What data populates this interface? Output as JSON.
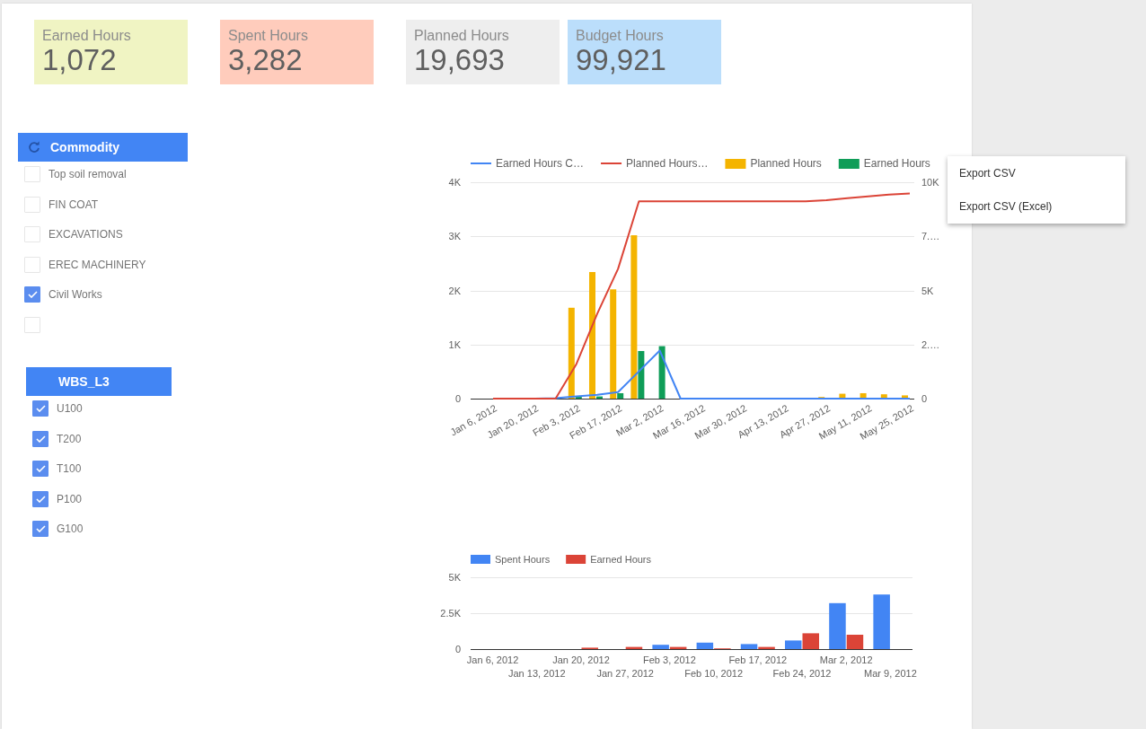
{
  "scorecards": [
    {
      "label": "Earned Hours",
      "value": "1,072",
      "color": "#f0f4c3"
    },
    {
      "label": "Spent Hours",
      "value": "3,282",
      "color": "#ffccbc"
    },
    {
      "label": "Planned Hours",
      "value": "19,693",
      "color": "#eeeeee"
    },
    {
      "label": "Budget Hours",
      "value": "99,921",
      "color": "#bbdefb"
    }
  ],
  "filters": [
    {
      "title": "Commodity",
      "show_reset": true,
      "options": [
        {
          "label": "Top soil removal",
          "checked": false
        },
        {
          "label": "FIN COAT",
          "checked": false
        },
        {
          "label": "EXCAVATIONS",
          "checked": false
        },
        {
          "label": "EREC MACHINERY",
          "checked": false
        },
        {
          "label": "Civil Works",
          "checked": true
        },
        {
          "checked": false
        }
      ]
    },
    {
      "title": "WBS_L3",
      "show_reset": false,
      "options": [
        {
          "label": "U100",
          "checked": true
        },
        {
          "label": "T200",
          "checked": true
        },
        {
          "label": "T100",
          "checked": true
        },
        {
          "label": "P100",
          "checked": true
        },
        {
          "label": "G100",
          "checked": true
        }
      ]
    }
  ],
  "charts": [
    {
      "chart_data": {
        "type": "bar",
        "legend": "top",
        "grid": true,
        "categories": [
          "Jan 6, 2012",
          null,
          "Jan 20, 2012",
          null,
          "Feb 3, 2012",
          null,
          "Feb 17, 2012",
          null,
          "Mar 2, 2012",
          null,
          "Mar 16, 2012",
          null,
          "Mar 30, 2012",
          null,
          "Apr 13, 2012",
          null,
          "Apr 27, 2012",
          null,
          "May 11, 2012",
          null,
          "May 25, 2012"
        ],
        "ylim": [
          0,
          4000
        ],
        "yticks": [
          {
            "value": 0,
            "label": "0"
          },
          {
            "value": 1000,
            "label": "1K"
          },
          {
            "value": 2000,
            "label": "2K"
          },
          {
            "value": 3000,
            "label": "3K"
          },
          {
            "value": 4000,
            "label": "4K"
          }
        ],
        "y2lim": [
          0,
          10000
        ],
        "y2ticks": [
          {
            "value": 0,
            "label": "0"
          },
          {
            "value": 2500,
            "label": "2.…"
          },
          {
            "value": 5000,
            "label": "5K"
          },
          {
            "value": 7500,
            "label": "7.…"
          },
          {
            "value": 10000,
            "label": "10K"
          }
        ],
        "series": [
          {
            "name": "Earned Hours C…",
            "color": "#4285f4",
            "type": "line",
            "axis": "y2",
            "values": [
              null,
              null,
              0,
              20,
              100,
              180,
              300,
              1260,
              2220,
              0,
              0,
              0,
              0,
              0,
              0,
              0,
              0,
              0,
              0,
              0,
              0
            ]
          },
          {
            "name": "Planned Hours…",
            "color": "#db4437",
            "type": "line",
            "axis": "y2",
            "values": [
              0,
              0,
              0,
              0,
              1600,
              3930,
              6000,
              9120,
              9120,
              9120,
              9120,
              9120,
              9120,
              9120,
              9120,
              9120,
              9170,
              9260,
              9350,
              9430,
              9480
            ]
          },
          {
            "name": "Planned Hours",
            "color": "#f4b400",
            "values": [
              0,
              0,
              0,
              0,
              1680,
              2340,
              2020,
              3020,
              0,
              0,
              0,
              0,
              0,
              0,
              0,
              0,
              30,
              90,
              100,
              80,
              60
            ]
          },
          {
            "name": "Earned Hours",
            "color": "#0f9d58",
            "values": [
              0,
              0,
              0,
              0,
              40,
              40,
              100,
              880,
              970,
              0,
              0,
              0,
              0,
              0,
              0,
              0,
              0,
              0,
              0,
              0,
              0
            ]
          }
        ]
      }
    },
    {
      "chart_data": {
        "type": "bar",
        "legend": "top",
        "grid": true,
        "categories": [
          "Jan 6, 2012",
          "Jan 13, 2012",
          "Jan 20, 2012",
          "Jan 27, 2012",
          "Feb 3, 2012",
          "Feb 10, 2012",
          "Feb 17, 2012",
          "Feb 24, 2012",
          "Mar 2, 2012",
          "Mar 9, 2012"
        ],
        "ylim": [
          0,
          5000
        ],
        "yticks": [
          {
            "value": 0,
            "label": "0"
          },
          {
            "value": 2500,
            "label": "2.5K"
          },
          {
            "value": 5000,
            "label": "5K"
          }
        ],
        "series": [
          {
            "name": "Spent Hours",
            "color": "#4285f4",
            "values": [
              0,
              0,
              0,
              0,
              300,
              450,
              350,
              600,
              3200,
              3800
            ]
          },
          {
            "name": "Earned Hours",
            "color": "#db4437",
            "values": [
              0,
              0,
              100,
              150,
              150,
              50,
              150,
              1100,
              1000,
              0
            ]
          }
        ]
      }
    }
  ],
  "context_menu": {
    "items": [
      "Export CSV",
      "Export CSV (Excel)"
    ]
  }
}
